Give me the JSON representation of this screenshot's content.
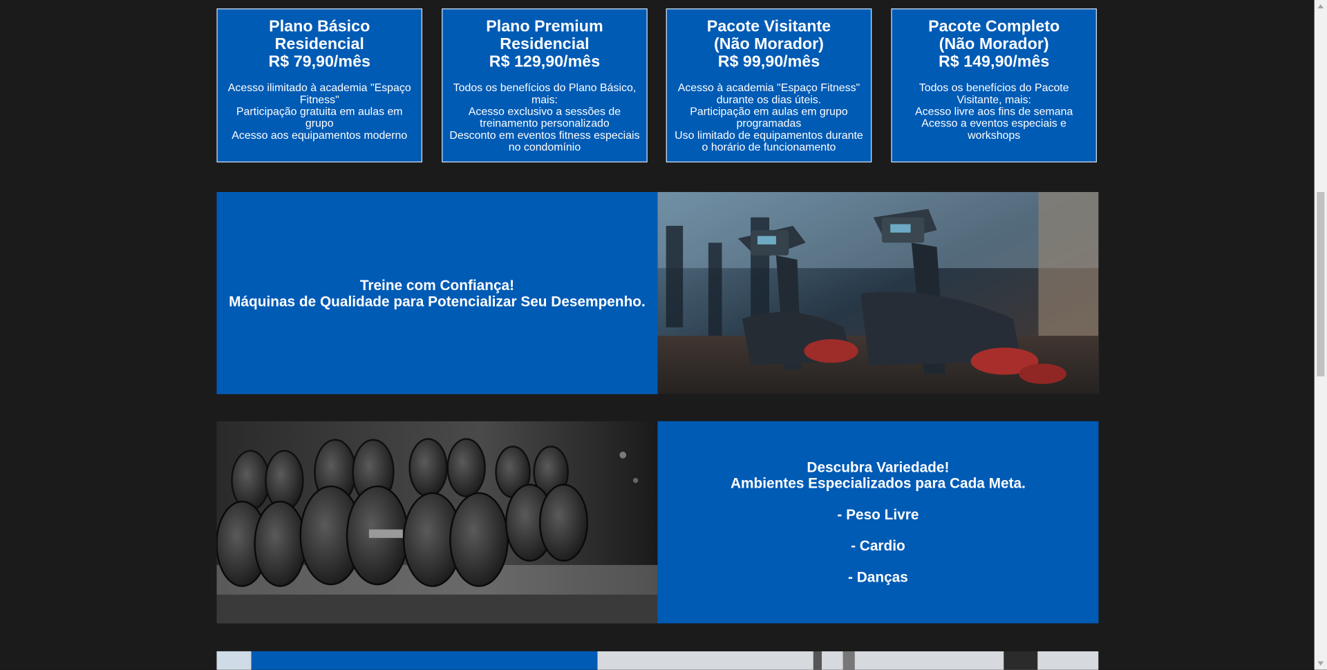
{
  "plans": [
    {
      "title": "Plano Básico\nResidencial",
      "price": "R$ 79,90/mês",
      "features": [
        "Acesso ilimitado à academia \"Espaço Fitness\"",
        "Participação gratuita em aulas em grupo",
        "Acesso aos equipamentos moderno"
      ]
    },
    {
      "title": "Plano Premium\nResidencial",
      "price": "R$ 129,90/mês",
      "features": [
        "Todos os benefícios do Plano Básico, mais:",
        "Acesso exclusivo a sessões de treinamento personalizado",
        "Desconto em eventos fitness especiais no condomínio"
      ]
    },
    {
      "title": "Pacote Visitante\n(Não Morador)",
      "price": "R$ 99,90/mês",
      "features": [
        "Acesso à academia \"Espaço Fitness\" durante os dias úteis.",
        "Participação em aulas em grupo programadas",
        "Uso limitado de equipamentos durante o horário de funcionamento"
      ]
    },
    {
      "title": "Pacote Completo\n(Não Morador)",
      "price": "R$ 149,90/mês",
      "features": [
        "Todos os benefícios do Pacote Visitante, mais:",
        "Acesso livre aos fins de semana",
        "Acesso a eventos especiais e workshops"
      ]
    }
  ],
  "banner_machines": {
    "line1": "Treine com Confiança!",
    "line2": "Máquinas de Qualidade para Potencializar Seu Desempenho."
  },
  "banner_variety": {
    "line1": "Descubra Variedade!",
    "line2": "Ambientes Especializados para Cada Meta.",
    "items": [
      "- Peso Livre",
      "- Cardio",
      "- Danças"
    ]
  },
  "colors": {
    "page_background": "#1b1b1b",
    "card_blue": "#005bb5",
    "text": "#ffffff"
  },
  "icons": {
    "scroll_up": "triangle-up-icon",
    "scroll_down": "triangle-down-icon"
  }
}
